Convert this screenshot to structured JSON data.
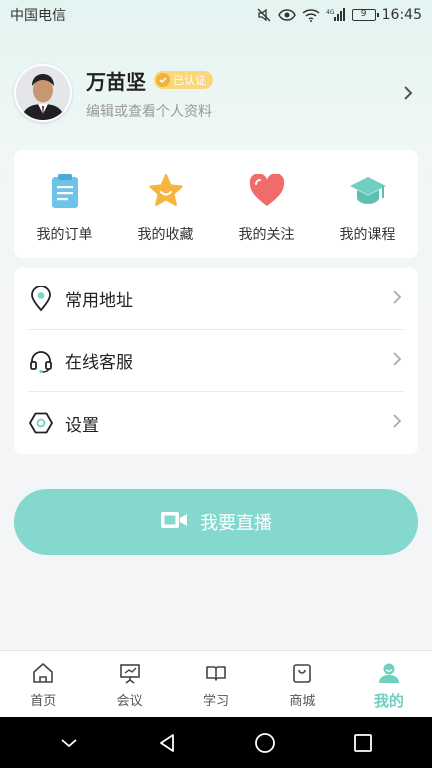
{
  "status_bar": {
    "carrier": "中国电信",
    "battery": "9",
    "time": "16:45",
    "network": "4G"
  },
  "profile": {
    "name": "万苗坚",
    "badge": "已认证",
    "subtitle": "编辑或查看个人资料"
  },
  "quick_links": [
    {
      "label": "我的订单",
      "icon": "clipboard-icon",
      "color": "#6ec3ea"
    },
    {
      "label": "我的收藏",
      "icon": "star-icon",
      "color": "#f6b53c"
    },
    {
      "label": "我的关注",
      "icon": "heart-icon",
      "color": "#f26b6b"
    },
    {
      "label": "我的课程",
      "icon": "graduation-cap-icon",
      "color": "#6fd0c2"
    }
  ],
  "menu": [
    {
      "label": "常用地址",
      "icon": "location-pin-icon"
    },
    {
      "label": "在线客服",
      "icon": "headset-icon"
    },
    {
      "label": "设置",
      "icon": "settings-hexagon-icon"
    }
  ],
  "live_button": {
    "label": "我要直播",
    "icon": "video-camera-icon"
  },
  "tabs": [
    {
      "label": "首页",
      "icon": "home-icon",
      "active": false
    },
    {
      "label": "会议",
      "icon": "presentation-icon",
      "active": false
    },
    {
      "label": "学习",
      "icon": "book-icon",
      "active": false
    },
    {
      "label": "商城",
      "icon": "shopping-bag-icon",
      "active": false
    },
    {
      "label": "我的",
      "icon": "user-icon",
      "active": true
    }
  ],
  "colors": {
    "accent": "#85d8cd",
    "tab_active": "#6fd0c2",
    "badge": "#fbd67a"
  }
}
